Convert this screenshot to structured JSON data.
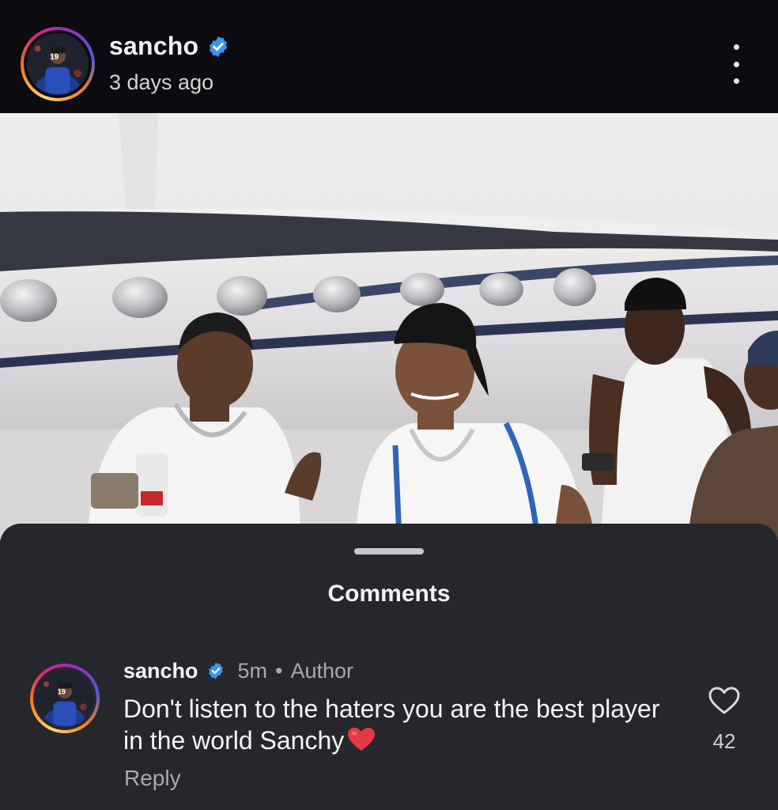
{
  "post": {
    "username": "sancho",
    "time": "3 days ago",
    "avatar_jersey_number": "19"
  },
  "icons": {
    "verified": "verified-badge-icon",
    "more": "more-options-icon",
    "like": "heart-outline-icon",
    "heart_emoji": "red-heart-emoji"
  },
  "colors": {
    "verified_blue": "#3897f0",
    "sheet_background": "#26272c",
    "header_background": "#0c0c10",
    "heart_red": "#e63946"
  },
  "comments_sheet": {
    "title": "Comments"
  },
  "comment": {
    "username": "sancho",
    "time": "5m",
    "separator": "•",
    "role": "Author",
    "text": "Don't listen to the haters you are the best player in the world Sanchy",
    "reply_label": "Reply",
    "like_count": "42",
    "avatar_jersey_number": "19"
  }
}
